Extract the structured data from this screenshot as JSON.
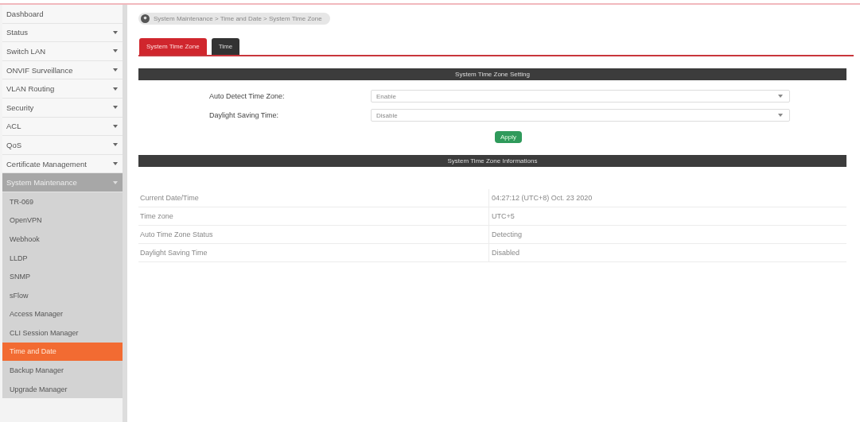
{
  "sidebar": {
    "items": [
      {
        "label": "Dashboard",
        "has_caret": false,
        "expanded": false
      },
      {
        "label": "Status",
        "has_caret": true,
        "expanded": false
      },
      {
        "label": "Switch LAN",
        "has_caret": true,
        "expanded": false
      },
      {
        "label": "ONVIF Surveillance",
        "has_caret": true,
        "expanded": false
      },
      {
        "label": "VLAN Routing",
        "has_caret": true,
        "expanded": false
      },
      {
        "label": "Security",
        "has_caret": true,
        "expanded": false
      },
      {
        "label": "ACL",
        "has_caret": true,
        "expanded": false
      },
      {
        "label": "QoS",
        "has_caret": true,
        "expanded": false
      },
      {
        "label": "Certificate Management",
        "has_caret": true,
        "expanded": false
      },
      {
        "label": "System Maintenance",
        "has_caret": true,
        "expanded": true,
        "children": [
          {
            "label": "TR-069",
            "selected": false
          },
          {
            "label": "OpenVPN",
            "selected": false
          },
          {
            "label": "Webhook",
            "selected": false
          },
          {
            "label": "LLDP",
            "selected": false
          },
          {
            "label": "SNMP",
            "selected": false
          },
          {
            "label": "sFlow",
            "selected": false
          },
          {
            "label": "Access Manager",
            "selected": false
          },
          {
            "label": "CLI Session Manager",
            "selected": false
          },
          {
            "label": "Time and Date",
            "selected": true
          },
          {
            "label": "Backup Manager",
            "selected": false
          },
          {
            "label": "Upgrade Manager",
            "selected": false
          }
        ]
      }
    ]
  },
  "breadcrumb": "System Maintenance > Time and Date > System Time Zone",
  "tabs": [
    {
      "label": "System Time Zone",
      "selected": true
    },
    {
      "label": "Time",
      "selected": false
    }
  ],
  "setting": {
    "title": "System Time Zone Setting",
    "fields": [
      {
        "label": "Auto Detect Time Zone:",
        "value": "Enable"
      },
      {
        "label": "Daylight Saving Time:",
        "value": "Disable"
      }
    ],
    "apply": "Apply"
  },
  "info": {
    "title": "System Time Zone Informations",
    "rows": [
      {
        "name": "Current Date/Time",
        "value": "04:27:12 (UTC+8) Oct. 23 2020"
      },
      {
        "name": "Time zone",
        "value": "UTC+5"
      },
      {
        "name": "Auto Time Zone Status",
        "value": "Detecting"
      },
      {
        "name": "Daylight Saving Time",
        "value": "Disabled"
      }
    ]
  }
}
